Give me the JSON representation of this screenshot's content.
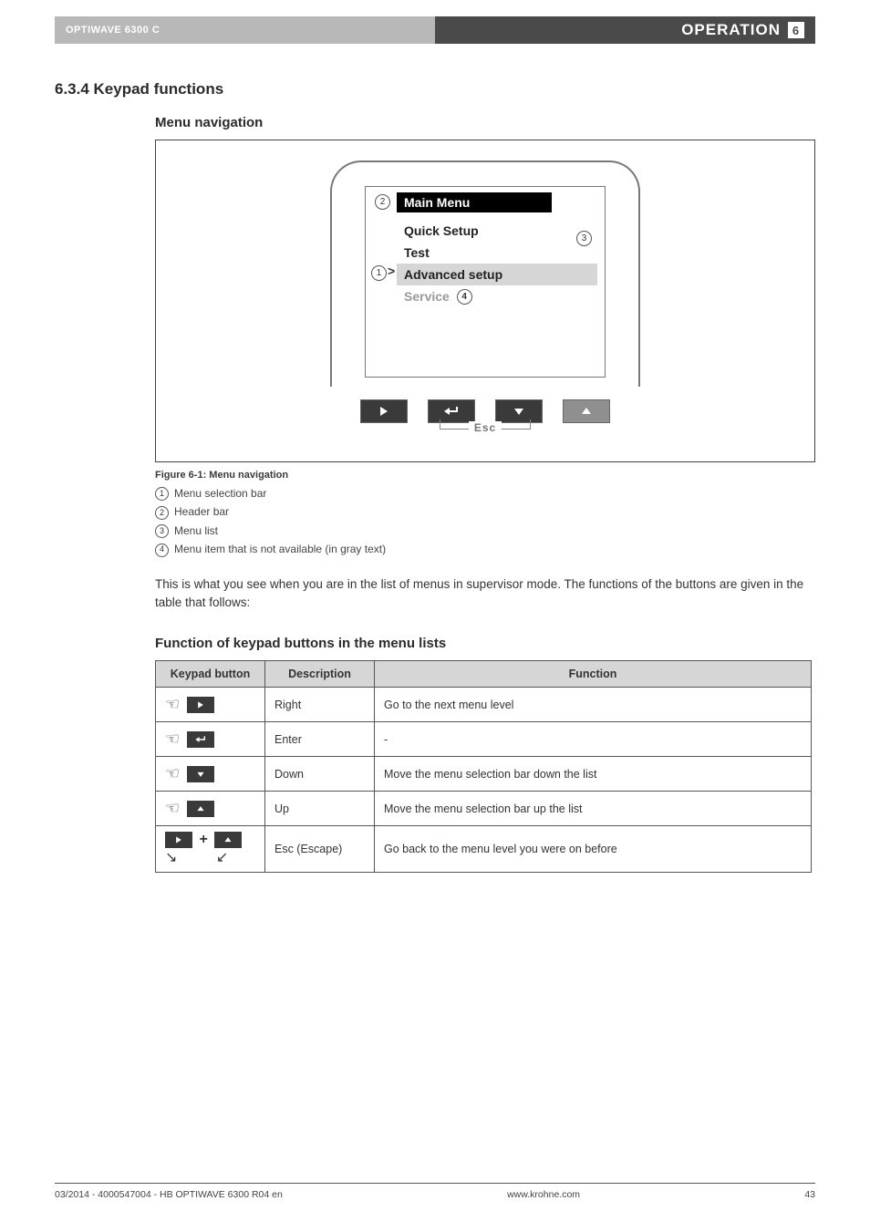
{
  "header": {
    "product": "OPTIWAVE 6300 C",
    "section_label": "OPERATION",
    "section_num": "6"
  },
  "section_title": "6.3.4  Keypad functions",
  "subhead": "Menu navigation",
  "screen": {
    "header": "Main Menu",
    "items": [
      "Quick Setup",
      "Test",
      "Advanced setup",
      "Service"
    ],
    "selected_index": 2,
    "disabled_index": 3,
    "selector_prefix": ">"
  },
  "markers": {
    "m1": "1",
    "m2": "2",
    "m3": "3",
    "m4": "4"
  },
  "esc_label": "Esc",
  "caption": "Figure 6-1: Menu navigation",
  "legend": [
    "Menu selection bar",
    "Header bar",
    "Menu list",
    "Menu item that is not available (in gray text)"
  ],
  "paragraph": "This is what you see when you are in the list of menus in supervisor mode. The functions of the buttons are given in the table that follows:",
  "table_title": "Function of keypad buttons in the menu lists",
  "table": {
    "cols": [
      "Keypad button",
      "Description",
      "Function"
    ],
    "rows": [
      {
        "key": "right",
        "desc": "Right",
        "func": "Go to the next menu level"
      },
      {
        "key": "enter",
        "desc": "Enter",
        "func": "-"
      },
      {
        "key": "down",
        "desc": "Down",
        "func": "Move the menu selection bar down the list"
      },
      {
        "key": "up",
        "desc": "Up",
        "func": "Move the menu selection bar up the list"
      },
      {
        "key": "esc",
        "desc": "Esc (Escape)",
        "func": "Go back to the menu level you were on before"
      }
    ]
  },
  "footer": {
    "left": "03/2014 - 4000547004 - HB OPTIWAVE 6300 R04 en",
    "center": "www.krohne.com",
    "right": "43"
  }
}
